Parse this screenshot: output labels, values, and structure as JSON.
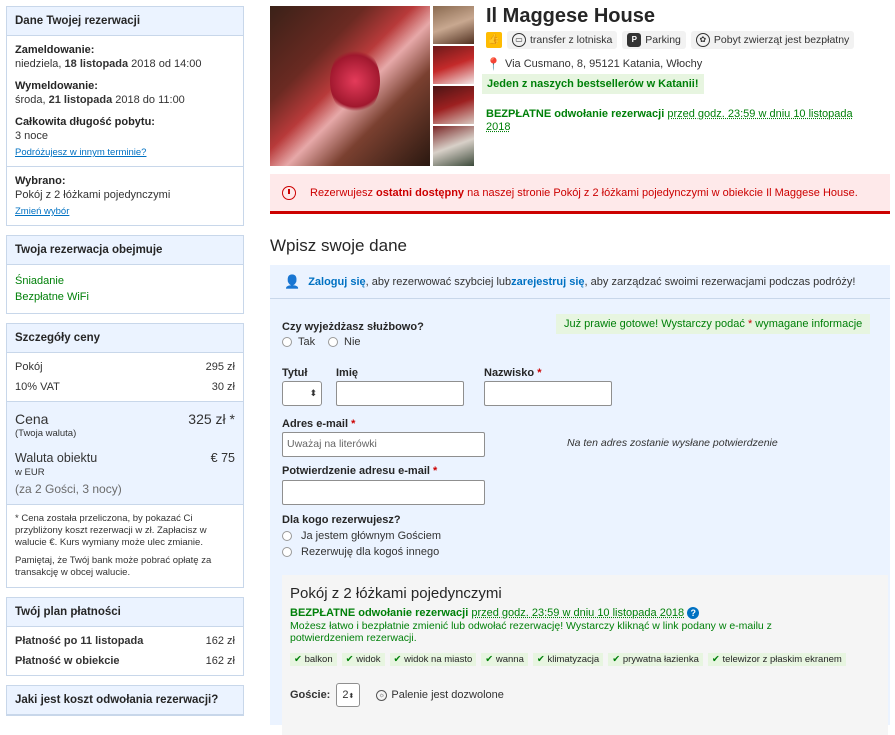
{
  "sidebar": {
    "reservation": {
      "title": "Dane Twojej rezerwacji",
      "checkin_label": "Zameldowanie:",
      "checkin_day": "niedziela, ",
      "checkin_date": "18 listopada",
      "checkin_rest": " 2018 od 14:00",
      "checkout_label": "Wymeldowanie:",
      "checkout_day": "środa, ",
      "checkout_date": "21 listopada",
      "checkout_rest": " 2018 do 11:00",
      "length_label": "Całkowita długość pobytu:",
      "length_value": "3 noce",
      "other_date_link": "Podróżujesz w innym terminie?",
      "selected_label": "Wybrano:",
      "selected_value": "Pokój z 2 łóżkami pojedynczymi",
      "change_link": "Zmień wybór"
    },
    "includes": {
      "title": "Twoja rezerwacja obejmuje",
      "items": [
        "Śniadanie",
        "Bezpłatne WiFi"
      ]
    },
    "price": {
      "title": "Szczegóły ceny",
      "room_label": "Pokój",
      "room_value": "295 zł",
      "vat_label": "10% VAT",
      "vat_value": "30 zł",
      "total_label": "Cena",
      "total_value": "325 zł *",
      "total_sub": "(Twoja waluta)",
      "prop_label": "Waluta obiektu",
      "prop_sub": "w EUR",
      "prop_value": "€ 75",
      "guests": "(za 2 Gości, 3 nocy)",
      "note1": "* Cena została przeliczona, by pokazać Ci przybliżony koszt rezerwacji w zł. Zapłacisz w walucie €. Kurs wymiany może ulec zmianie.",
      "note2": "Pamiętaj, że Twój bank może pobrać opłatę za transakcję w obcej walucie."
    },
    "payment": {
      "title": "Twój plan płatności",
      "row1_label": "Płatność po 11 listopada",
      "row1_value": "162 zł",
      "row2_label": "Płatność w obiekcie",
      "row2_value": "162 zł"
    },
    "cancel": {
      "title": "Jaki jest koszt odwołania rezerwacji?"
    }
  },
  "hotel": {
    "name": "Il Maggese House",
    "badge_transfer": "transfer z lotniska",
    "badge_parking": "Parking",
    "badge_pets": "Pobyt zwierząt jest bezpłatny",
    "address": "Via Cusmano, 8, 95121 Katania, Włochy",
    "bestseller": "Jeden z naszych bestsellerów w Katanii!",
    "free_cancel": "BEZPŁATNE odwołanie rezerwacji",
    "free_cancel_until": "przed godz. 23:59 w dniu 10 listopada 2018"
  },
  "alert": {
    "pre": "Rezerwujesz ",
    "strong": "ostatni dostępny",
    "post": " na naszej stronie Pokój z 2 łóżkami pojedynczymi w obiekcie Il Maggese House."
  },
  "form": {
    "title": "Wpisz swoje dane",
    "login_link": "Zaloguj się",
    "login_mid": ", aby rezerwować szybciej lub ",
    "register_link": "zarejestruj się",
    "login_post": ", aby zarządzać swoimi rezerwacjami podczas podróży!",
    "business_label": "Czy wyjeżdżasz służbowo?",
    "yes": "Tak",
    "no": "Nie",
    "almost_pre": "Już prawie gotowe! Wystarczy podać ",
    "almost_star": "*",
    "almost_post": " wymagane informacje",
    "title_label": "Tytuł",
    "firstname_label": "Imię",
    "lastname_label": "Nazwisko",
    "email_label": "Adres e-mail",
    "email_placeholder": "Uważaj na literówki",
    "email_hint": "Na ten adres zostanie wysłane potwierdzenie",
    "email_confirm_label": "Potwierdzenie adresu e-mail",
    "for_whom_label": "Dla kogo rezerwujesz?",
    "for_me": "Ja jestem głównym Gościem",
    "for_other": "Rezerwuję dla kogoś innego",
    "required_star": "*"
  },
  "room": {
    "title": "Pokój z 2 łóżkami pojedynczymi",
    "free_cancel": "BEZPŁATNE odwołanie rezerwacji",
    "free_cancel_until": "przed godz. 23:59 w dniu 10 listopada 2018",
    "desc": "Możesz łatwo i bezpłatnie zmienić lub odwołać rezerwację! Wystarczy kliknąć w link podany w e-mailu z potwierdzeniem rezerwacji.",
    "amenities": [
      "balkon",
      "widok",
      "widok na miasto",
      "wanna",
      "klimatyzacja",
      "prywatna łazienka",
      "telewizor z płaskim ekranem"
    ],
    "guests_label": "Goście:",
    "guests_value": "2",
    "smoking": "Palenie jest dozwolone"
  }
}
